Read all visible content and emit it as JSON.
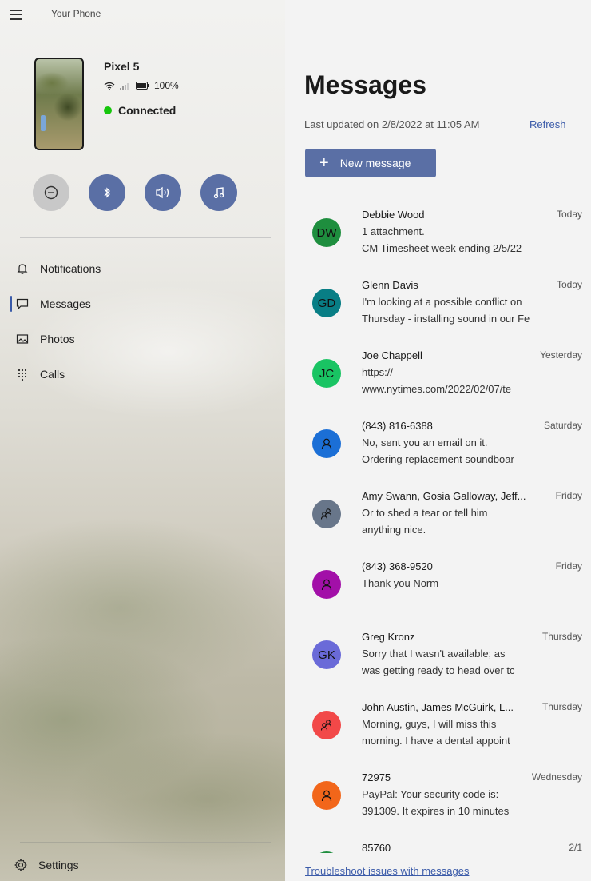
{
  "app": {
    "title": "Your Phone"
  },
  "device": {
    "name": "Pixel 5",
    "battery": "100%",
    "connection": "Connected"
  },
  "nav": [
    {
      "label": "Notifications",
      "icon": "bell-icon"
    },
    {
      "label": "Messages",
      "icon": "chat-icon",
      "active": true
    },
    {
      "label": "Photos",
      "icon": "photo-icon"
    },
    {
      "label": "Calls",
      "icon": "dialpad-icon"
    }
  ],
  "settings": {
    "label": "Settings"
  },
  "messages": {
    "title": "Messages",
    "last_updated": "Last updated on 2/8/2022 at 11:05 AM",
    "refresh_label": "Refresh",
    "new_message_label": "New message",
    "conversations": [
      {
        "name": "Debbie Wood",
        "date": "Today",
        "line1": "1 attachment.",
        "line2": "CM Timesheet week ending 2/5/22",
        "initials": "DW",
        "color": "#1e8e3e"
      },
      {
        "name": "Glenn Davis",
        "date": "Today",
        "line1": "I'm looking at a possible conflict on",
        "line2": "Thursday - installing sound in our Fe",
        "initials": "GD",
        "color": "#087e85"
      },
      {
        "name": "Joe Chappell",
        "date": "Yesterday",
        "line1": "https://",
        "line2": "www.nytimes.com/2022/02/07/te",
        "initials": "JC",
        "color": "#19c463"
      },
      {
        "name": "(843) 816-6388",
        "date": "Saturday",
        "line1": "No,  sent you an email on it.",
        "line2": "Ordering replacement soundboar",
        "initials": "",
        "color": "#1b6fd6"
      },
      {
        "name": "Amy Swann, Gosia Galloway, Jeff...",
        "date": "Friday",
        "line1": "Or to shed a tear or tell him",
        "line2": "anything nice.",
        "initials": "",
        "color": "#68768a",
        "group": true
      },
      {
        "name": "(843) 368-9520",
        "date": "Friday",
        "line1": "Thank you Norm",
        "line2": "",
        "initials": "",
        "color": "#a20fa8"
      },
      {
        "name": "Greg Kronz",
        "date": "Thursday",
        "line1": "Sorry that I wasn't available; as",
        "line2": "was getting ready to head over tc",
        "initials": "GK",
        "color": "#6a6ad8"
      },
      {
        "name": "John Austin, James McGuirk, L...",
        "date": "Thursday",
        "line1": "Morning, guys, I will miss this",
        "line2": "morning.  I have a dental appoint",
        "initials": "",
        "color": "#f24848",
        "group": true
      },
      {
        "name": "72975",
        "date": "Wednesday",
        "line1": "PayPal: Your security code is:",
        "line2": "391309. It expires in 10 minutes",
        "initials": "",
        "color": "#f2661a"
      },
      {
        "name": "85760",
        "date": "2/1",
        "line1": "",
        "line2": "",
        "initials": "",
        "color": "#1e8e3e"
      }
    ],
    "troubleshoot_label": "Troubleshoot issues with messages"
  }
}
